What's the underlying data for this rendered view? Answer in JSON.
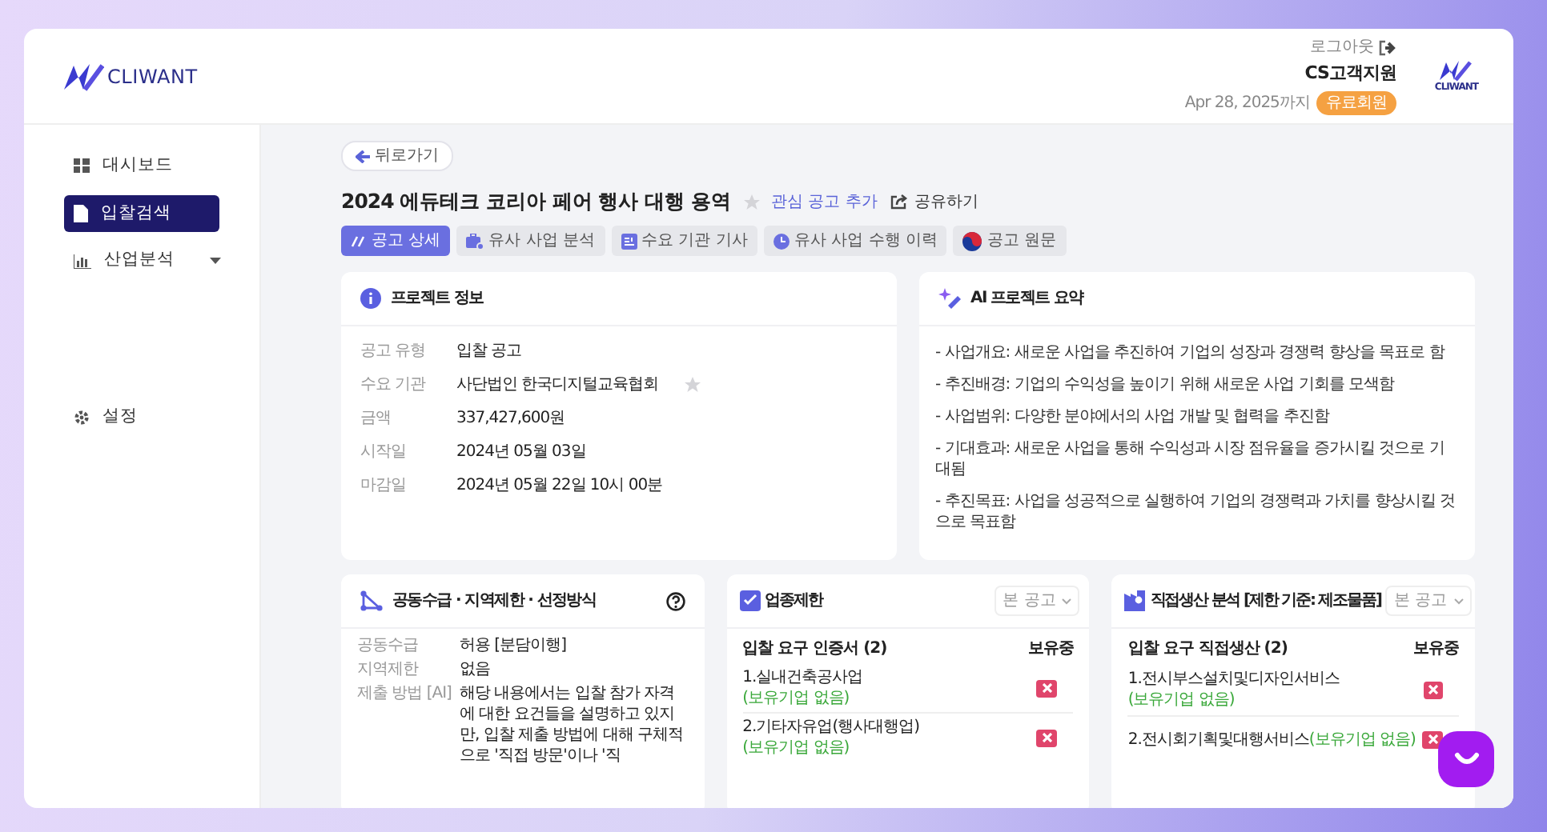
{
  "header": {
    "logo_text": "CLIWANT",
    "logout": "로그아웃",
    "user": "CS고객지원",
    "expiry": "Apr 28, 2025까지",
    "plan_badge": "유료회원",
    "small_logo_text": "CLIWANT"
  },
  "sidebar": {
    "items": [
      {
        "label": "대시보드",
        "kind": "link",
        "selected": false
      },
      {
        "label": "입찰검색",
        "kind": "link",
        "selected": true
      },
      {
        "label": "산업분석",
        "kind": "dropdown",
        "selected": false
      }
    ],
    "settings": "설정"
  },
  "back": "뒤로가기",
  "title": "2024 에듀테크 코리아 페어 행사 대행 용역",
  "favorite": {
    "label": "관심 공고 추가",
    "starred": false
  },
  "share": "공유하기",
  "tabs": [
    {
      "label": "공고 상세",
      "selected": true
    },
    {
      "label": "유사 사업 분석",
      "selected": false
    },
    {
      "label": "수요 기관 기사",
      "selected": false
    },
    {
      "label": "유사 사업 수행 이력",
      "selected": false
    },
    {
      "label": "공고 원문",
      "selected": false
    }
  ],
  "project_info": {
    "title": "프로젝트 정보",
    "fields": [
      {
        "label": "공고 유형",
        "value": "입찰 공고"
      },
      {
        "label": "수요 기관",
        "value": "사단법인 한국디지털교육협회",
        "starred": false
      },
      {
        "label": "금액",
        "value": "337,427,600원"
      },
      {
        "label": "시작일",
        "value": "2024년 05월 03일"
      },
      {
        "label": "마감일",
        "value": "2024년 05월 22일 10시 00분"
      }
    ]
  },
  "ai_summary": {
    "title": "AI 프로젝트 요약",
    "lines": [
      "- 사업개요: 새로운 사업을 추진하여 기업의 성장과 경쟁력 향상을 목표로 함",
      "- 추진배경: 기업의 수익성을 높이기 위해 새로운 사업 기회를 모색함",
      "- 사업범위: 다양한 분야에서의 사업 개발 및 협력을 추진함",
      "- 기대효과: 새로운 사업을 통해 수익성과 시장 점유율을 증가시킬 것으로 기대됨",
      "- 추진목표: 사업을 성공적으로 실행하여 기업의 경쟁력과 가치를 향상시킬 것으로 목표함"
    ]
  },
  "consortium": {
    "title": "공동수급 · 지역제한 · 선정방식",
    "fields": [
      {
        "label": "공동수급",
        "value": "허용 [분담이행]"
      },
      {
        "label": "지역제한",
        "value": "없음"
      },
      {
        "label": "제출 방법 [AI]",
        "value": "해당 내용에서는 입찰 참가 자격에 대한 요건들을 설명하고 있지만, 입찰 제출 방법에 대해 구체적으로 '직접 방문'이나 '직"
      }
    ]
  },
  "industry": {
    "title": "업종제한",
    "select": "본 공고",
    "list_heading": "입찰 요구 인증서 (2)",
    "held_heading": "보유중",
    "items": [
      {
        "name": "1.실내건축공사업",
        "note": "(보유기업 없음)",
        "held": false
      },
      {
        "name": "2.기타자유업(행사대행업)",
        "note": "(보유기업 없음)",
        "held": false
      }
    ]
  },
  "direct_production": {
    "title": "직접생산 분석 [제한 기준: 제조물품]",
    "select": "본 공고",
    "list_heading": "입찰 요구 직접생산 (2)",
    "held_heading": "보유중",
    "items": [
      {
        "name": "1.전시부스설치및디자인서비스",
        "note": "(보유기업 없음)",
        "held": false
      },
      {
        "name": "2.전시회기획및대행서비스",
        "note": "(보유기업 없음)",
        "held": false
      }
    ]
  }
}
